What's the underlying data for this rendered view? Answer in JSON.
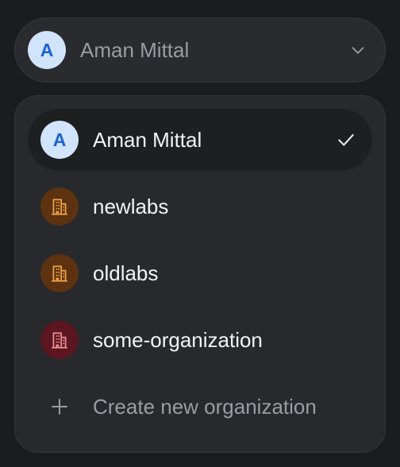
{
  "trigger": {
    "avatar_initial": "A",
    "name": "Aman Mittal",
    "chevron_icon": "chevron-down-icon"
  },
  "menu": {
    "items": [
      {
        "label": "Aman Mittal",
        "avatar_initial": "A",
        "type": "user",
        "selected": true
      },
      {
        "label": "newlabs",
        "type": "organization",
        "icon": "building-icon",
        "color": "#f0a24a"
      },
      {
        "label": "oldlabs",
        "type": "organization",
        "icon": "building-icon",
        "color": "#f0a24a"
      },
      {
        "label": "some-organization",
        "type": "organization",
        "icon": "building-icon",
        "color": "#ee8f99"
      }
    ],
    "create_label": "Create new organization"
  },
  "colors": {
    "background": "#1b1c1e",
    "panel": "#28292c",
    "selected_row": "#1e1f21",
    "user_avatar_bg": "#d2e3fc",
    "user_avatar_text": "#1a62d4",
    "org_brown_bg": "#5c3210",
    "org_red_bg": "#5c1620"
  }
}
